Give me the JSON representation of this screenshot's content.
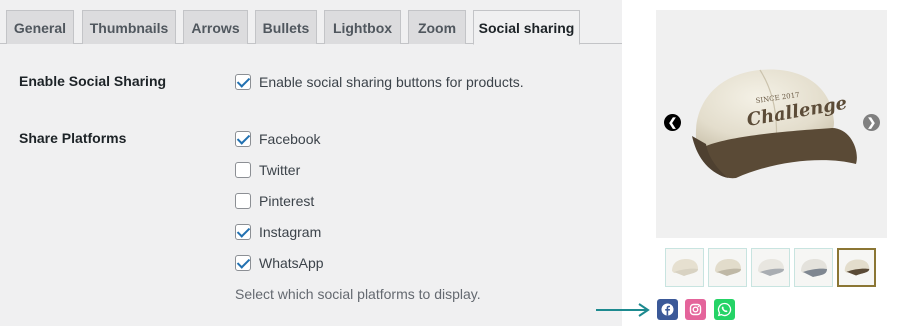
{
  "tabs": [
    {
      "label": "General"
    },
    {
      "label": "Thumbnails"
    },
    {
      "label": "Arrows"
    },
    {
      "label": "Bullets"
    },
    {
      "label": "Lightbox"
    },
    {
      "label": "Zoom"
    },
    {
      "label": "Social sharing"
    }
  ],
  "active_tab": "Social sharing",
  "enable_sharing": {
    "label": "Enable Social Sharing",
    "checkbox_label": "Enable social sharing buttons for products.",
    "checked": true
  },
  "share_platforms": {
    "label": "Share Platforms",
    "options": [
      {
        "label": "Facebook",
        "checked": true
      },
      {
        "label": "Twitter",
        "checked": false
      },
      {
        "label": "Pinterest",
        "checked": false
      },
      {
        "label": "Instagram",
        "checked": true
      },
      {
        "label": "WhatsApp",
        "checked": true
      }
    ],
    "help": "Select which social platforms to display."
  },
  "product_image": {
    "cap_text_top": "SINCE 2017",
    "cap_text_main": "Challenge"
  },
  "social_icons": [
    {
      "name": "facebook-icon",
      "color": "#3b5998"
    },
    {
      "name": "instagram-icon",
      "color": "#e4649b"
    },
    {
      "name": "whatsapp-icon",
      "color": "#25d366"
    }
  ],
  "colors": {
    "accent": "#2271b1",
    "pointer_arrow": "#1d8a8f",
    "active_thumb_border": "#8b7634"
  }
}
